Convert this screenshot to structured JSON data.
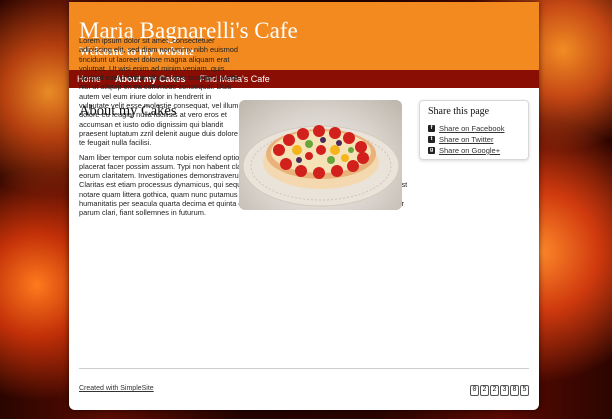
{
  "header": {
    "title": "Maria Bagnarelli's Cafe",
    "subtitle": "Welcome to my website"
  },
  "nav": {
    "items": [
      {
        "label": "Home"
      },
      {
        "label": "About my Cakes"
      },
      {
        "label": "Find Maria's Cafe"
      }
    ],
    "active": "About my Cakes"
  },
  "main": {
    "title": "About my Cakes",
    "paragraph1": "Lorem ipsum dolor sit amet, consectetuer adipiscing elit, sed diam nonummy nibh euismod tincidunt ut laoreet dolore magna aliquam erat volutpat. Ut wisi enim ad minim veniam, quis nostrud exerci tation ullamcorper suscipit lobortis nisl ut aliquip ex ea commodo consequat. Duis autem vel eum iriure dolor in hendrerit in vulputate velit esse molestie consequat, vel illum dolore eu feugiat nulla facilisis at vero eros et accumsan et iusto odio dignissim qui blandit praesent luptatum zzril delenit augue duis dolore te feugait nulla facilisi.",
    "paragraph2": "Nam liber tempor cum soluta nobis eleifend option congue nihil imperdiet doming id quod mazim placerat facer possim assum. Typi non habent claritatem insitam; est usus legentis in iis qui facit eorum claritatem. Investigationes demonstraverunt lectores legere me lius quod ii legunt saepius. Claritas est etiam processus dynamicus, qui sequitur mutationem consuetudium lectorum. Mirum est notare quam littera gothica, quam nunc putamus parum claram, anteposuerit litterarum formas humanitatis per seacula quarta decima et quinta decima. Eodem modo typi, qui nunc nobis videntur parum clari, fiant sollemnes in futurum."
  },
  "sidebar": {
    "title": "Share this page",
    "links": [
      {
        "label": "Share on Facebook",
        "icon": "facebook-icon",
        "glyph": "f"
      },
      {
        "label": "Share on Twitter",
        "icon": "twitter-icon",
        "glyph": "t"
      },
      {
        "label": "Share on Google+",
        "icon": "google-plus-icon",
        "glyph": "g"
      }
    ]
  },
  "footer": {
    "credit": "Created with SimpleSite",
    "counter": [
      "0",
      "2",
      "2",
      "3",
      "8",
      "5"
    ]
  },
  "colors": {
    "header": "#f28a20",
    "nav": "#8b0e05"
  }
}
